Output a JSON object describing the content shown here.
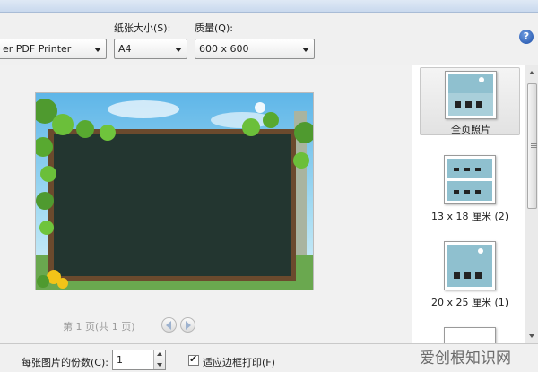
{
  "toolbar": {
    "printer_value": "er PDF Printer",
    "paper_size_label": "纸张大小(S):",
    "paper_size_value": "A4",
    "quality_label": "质量(Q):",
    "quality_value": "600 x 600",
    "help_glyph": "?"
  },
  "preview": {
    "page_info": "第 1 页(共 1 页)"
  },
  "layouts": {
    "items": [
      {
        "label": "全页照片",
        "selected": true
      },
      {
        "label": "13 x 18 厘米 (2)",
        "selected": false
      },
      {
        "label": "20 x 25 厘米 (1)",
        "selected": false
      }
    ]
  },
  "footer": {
    "copies_label": "每张图片的份数(C):",
    "copies_value": "1",
    "fit_label": "适应边框打印(F)",
    "fit_checked": true,
    "check_glyph": "✔"
  },
  "watermark": "爱创根知识网"
}
